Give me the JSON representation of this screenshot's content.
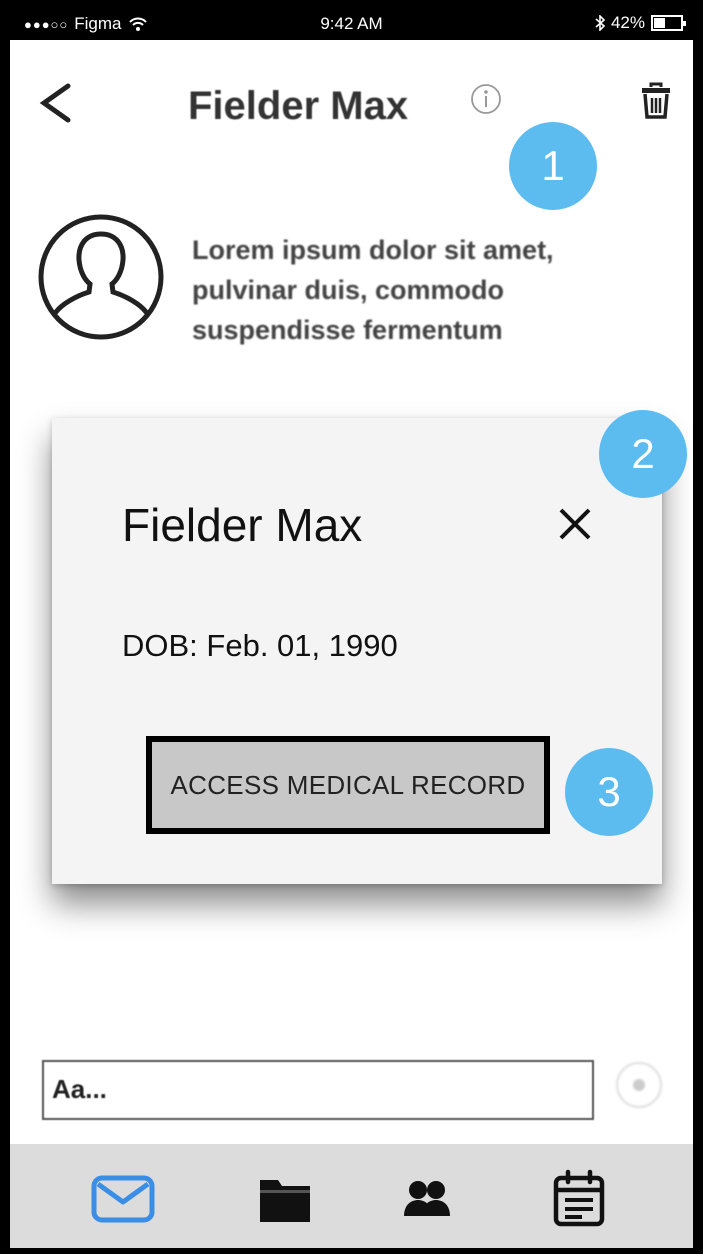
{
  "status_bar": {
    "carrier": "Figma",
    "time": "9:42 AM",
    "battery": "42%",
    "battery_level": 0.42
  },
  "header": {
    "title": "Fielder Max",
    "back_icon": "chevron-left-icon",
    "info_icon": "info-icon",
    "delete_icon": "trash-icon"
  },
  "profile": {
    "bio": "Lorem ipsum dolor sit amet, pulvinar duis, commodo suspendisse fermentum",
    "avatar_icon": "user-avatar-icon"
  },
  "annotations": [
    "1",
    "2",
    "3"
  ],
  "modal": {
    "title": "Fielder Max",
    "dob": "DOB: Feb. 01, 1990",
    "access_button": "ACCESS MEDICAL RECORD",
    "close_icon": "close-icon"
  },
  "composer": {
    "placeholder": "Aa..."
  },
  "bottom_nav": {
    "items": [
      "mail-icon",
      "folder-icon",
      "contacts-icon",
      "calendar-icon"
    ],
    "active_color": "#3a8ee6"
  },
  "colors": {
    "badge": "#5cbcf0",
    "button_bg": "#c8c8c8",
    "nav_bg": "#dcdcdc"
  }
}
